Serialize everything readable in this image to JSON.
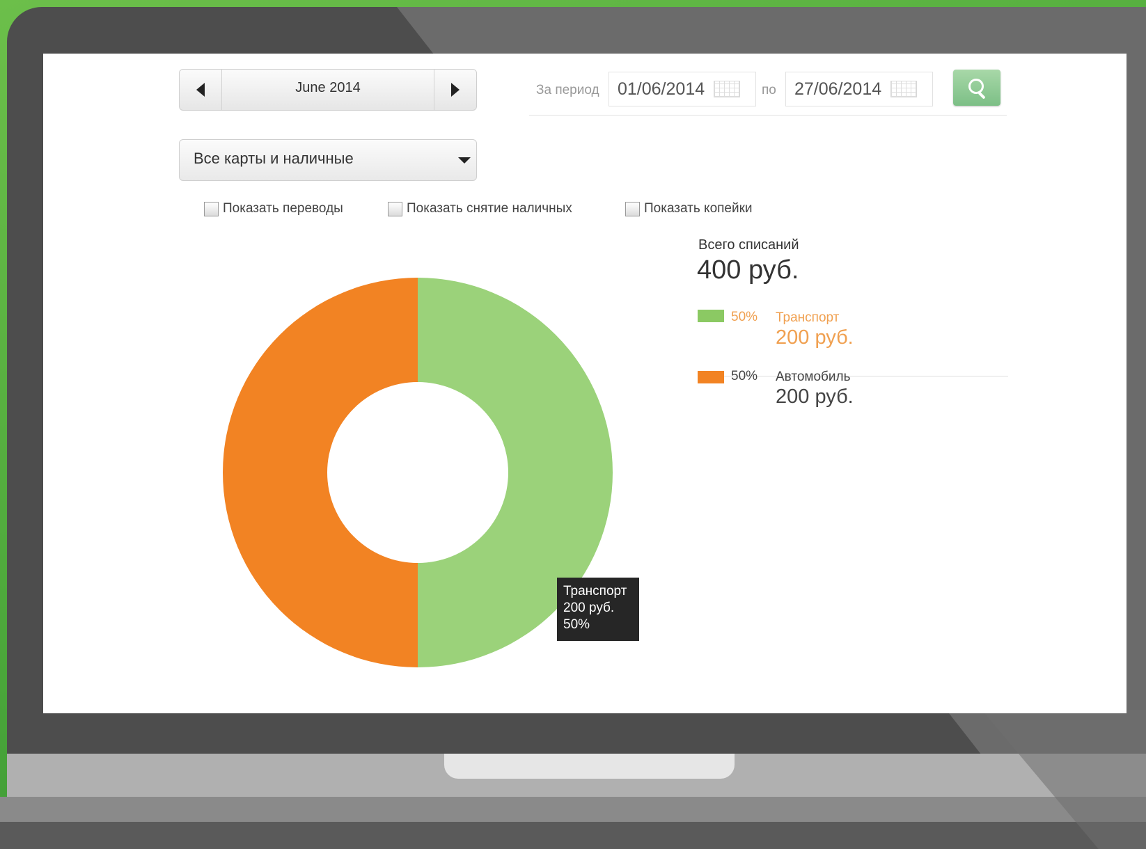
{
  "toolbar": {
    "month": "June 2014",
    "period_label": "За период",
    "date_from": "01/06/2014",
    "to_label": "по",
    "date_to": "27/06/2014"
  },
  "filter": {
    "selected": "Все карты и наличные"
  },
  "options": [
    {
      "label": "Показать переводы",
      "checked": false
    },
    {
      "label": "Показать снятие наличных",
      "checked": false
    },
    {
      "label": "Показать копейки",
      "checked": false
    }
  ],
  "summary": {
    "total_label": "Всего списаний",
    "total_value": "400 руб.",
    "items": [
      {
        "pct": "50%",
        "name": "Транспорт",
        "amount": "200 руб.",
        "color": "#8bc963",
        "text_color": "#f0a050"
      },
      {
        "pct": "50%",
        "name": "Автомобиль",
        "amount": "200 руб.",
        "color": "#f28323",
        "text_color": "#444444"
      }
    ]
  },
  "tooltip": {
    "line1": "Транспорт",
    "line2": "200 руб.",
    "line3": "50%"
  },
  "chart_data": {
    "type": "pie",
    "categories": [
      "Транспорт",
      "Автомобиль"
    ],
    "values": [
      200,
      200
    ],
    "percent": [
      50,
      50
    ],
    "colors": [
      "#9bd27a",
      "#f28323"
    ],
    "donut": true
  },
  "icons": {
    "prev": "chevron-left-icon",
    "next": "chevron-right-icon",
    "calendar": "calendar-icon",
    "search": "search-icon",
    "dropdown": "chevron-down-icon"
  }
}
